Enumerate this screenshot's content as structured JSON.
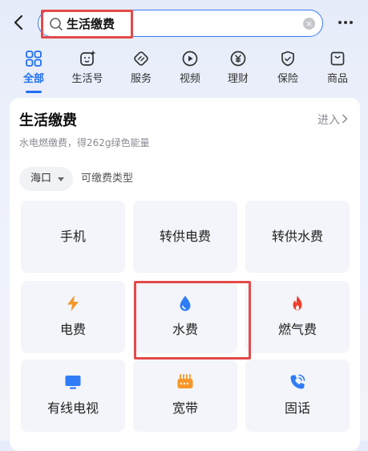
{
  "search": {
    "query": "生活缴费",
    "icon": "search-icon"
  },
  "tabs": [
    {
      "label": "全部",
      "icon": "grid-icon",
      "active": true
    },
    {
      "label": "生活号",
      "icon": "life-account-icon",
      "active": false
    },
    {
      "label": "服务",
      "icon": "service-icon",
      "active": false
    },
    {
      "label": "视频",
      "icon": "video-icon",
      "active": false
    },
    {
      "label": "理财",
      "icon": "yuan-icon",
      "active": false
    },
    {
      "label": "保险",
      "icon": "shield-icon",
      "active": false
    },
    {
      "label": "商品",
      "icon": "shopping-bag-icon",
      "active": false
    }
  ],
  "card": {
    "title": "生活缴费",
    "enter_label": "进入",
    "subtitle": "水电燃缴费，得262g绿色能量",
    "region": "海口",
    "pay_type_label": "可缴费类型",
    "tiles": [
      {
        "label": "手机",
        "icon": null
      },
      {
        "label": "转供电费",
        "icon": null
      },
      {
        "label": "转供水费",
        "icon": null
      },
      {
        "label": "电费",
        "icon": "lightning-icon",
        "color": "#f6972a"
      },
      {
        "label": "水费",
        "icon": "water-drop-icon",
        "color": "#2f7cf6"
      },
      {
        "label": "燃气费",
        "icon": "flame-icon",
        "color": "#ef3e2c"
      },
      {
        "label": "有线电视",
        "icon": "tv-icon",
        "color": "#2f7cf6"
      },
      {
        "label": "宽带",
        "icon": "broadband-icon",
        "color": "#f6972a"
      },
      {
        "label": "固话",
        "icon": "phone-icon",
        "color": "#2f7cf6"
      }
    ]
  },
  "colors": {
    "accent": "#1f6ff2",
    "highlight": "#e34a4a"
  }
}
